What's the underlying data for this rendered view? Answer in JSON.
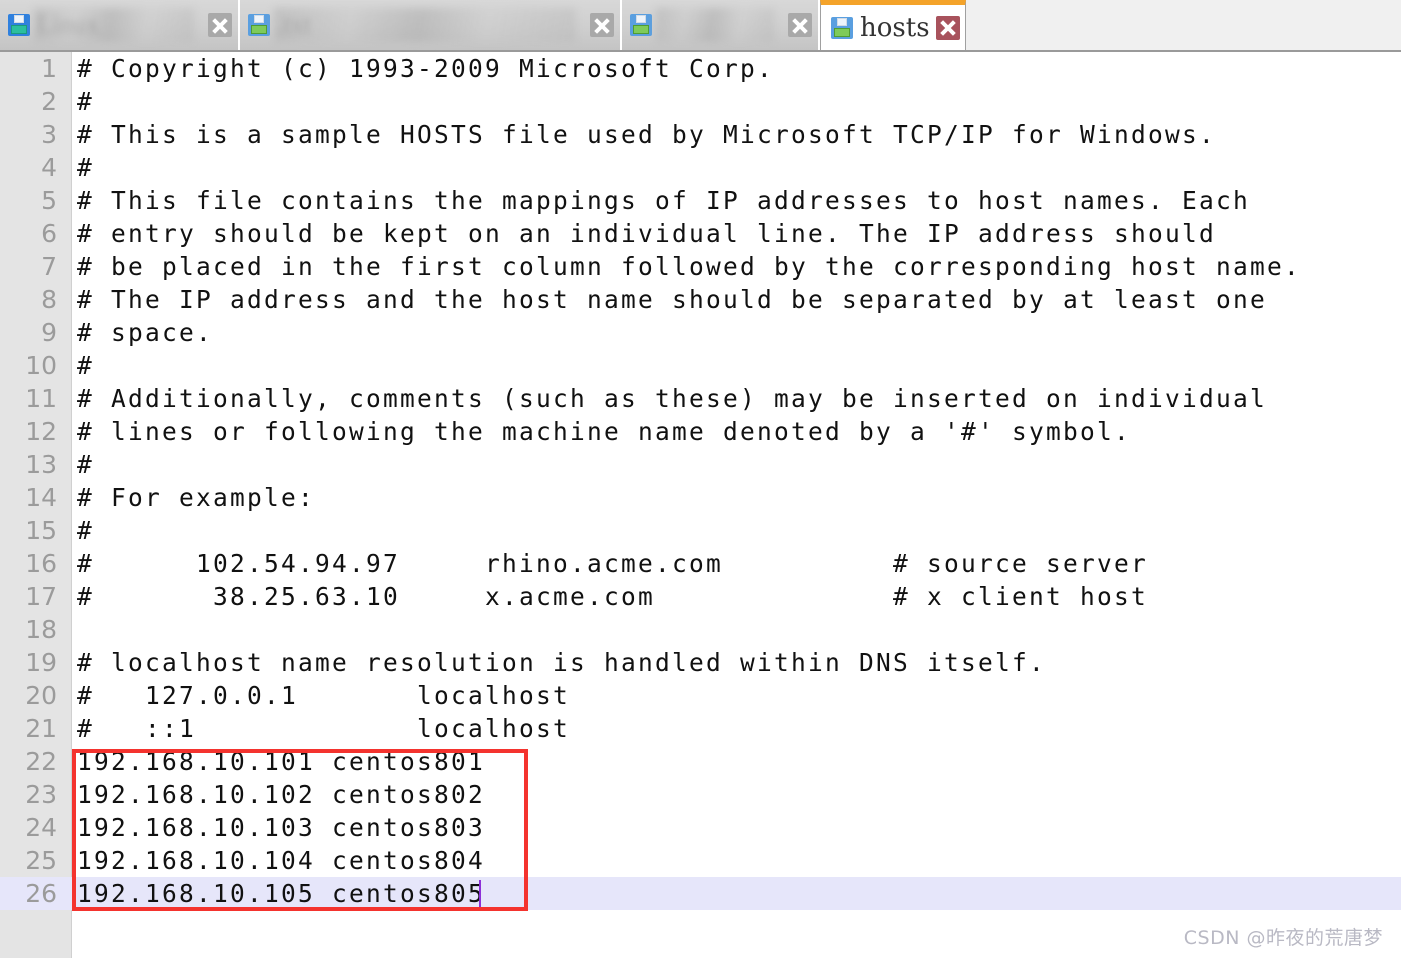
{
  "window": {
    "accent_active_tab": "#f4a32a",
    "annotation_color": "#f4332e",
    "current_line_highlight": "#e6e6fa",
    "gutter_color": "#e4e4e4"
  },
  "tabbar": {
    "tabs": [
      {
        "title": "Linux",
        "icon": "floppy-disk-icon",
        "close_icon": "close-icon",
        "active": false,
        "obscured": true
      },
      {
        "title": ".txt",
        "icon": "floppy-disk-icon",
        "close_icon": "close-icon",
        "active": false,
        "obscured": true
      },
      {
        "title": "",
        "icon": "floppy-disk-icon",
        "close_icon": "close-icon",
        "active": false,
        "obscured": true
      },
      {
        "title": "hosts",
        "icon": "floppy-disk-icon",
        "close_icon": "close-icon",
        "active": true,
        "obscured": false
      }
    ]
  },
  "editor": {
    "filename": "hosts",
    "cursor_line": 26,
    "lines": [
      {
        "n": "1",
        "text": "# Copyright (c) 1993-2009 Microsoft Corp."
      },
      {
        "n": "2",
        "text": "#"
      },
      {
        "n": "3",
        "text": "# This is a sample HOSTS file used by Microsoft TCP/IP for Windows."
      },
      {
        "n": "4",
        "text": "#"
      },
      {
        "n": "5",
        "text": "# This file contains the mappings of IP addresses to host names. Each"
      },
      {
        "n": "6",
        "text": "# entry should be kept on an individual line. The IP address should"
      },
      {
        "n": "7",
        "text": "# be placed in the first column followed by the corresponding host name."
      },
      {
        "n": "8",
        "text": "# The IP address and the host name should be separated by at least one"
      },
      {
        "n": "9",
        "text": "# space."
      },
      {
        "n": "10",
        "text": "#"
      },
      {
        "n": "11",
        "text": "# Additionally, comments (such as these) may be inserted on individual"
      },
      {
        "n": "12",
        "text": "# lines or following the machine name denoted by a '#' symbol."
      },
      {
        "n": "13",
        "text": "#"
      },
      {
        "n": "14",
        "text": "# For example:"
      },
      {
        "n": "15",
        "text": "#"
      },
      {
        "n": "16",
        "text": "#      102.54.94.97     rhino.acme.com          # source server"
      },
      {
        "n": "17",
        "text": "#       38.25.63.10     x.acme.com              # x client host"
      },
      {
        "n": "18",
        "text": ""
      },
      {
        "n": "19",
        "text": "# localhost name resolution is handled within DNS itself."
      },
      {
        "n": "20",
        "text": "#   127.0.0.1       localhost"
      },
      {
        "n": "21",
        "text": "#   ::1             localhost"
      },
      {
        "n": "22",
        "text": "192.168.10.101 centos801"
      },
      {
        "n": "23",
        "text": "192.168.10.102 centos802"
      },
      {
        "n": "24",
        "text": "192.168.10.103 centos803"
      },
      {
        "n": "25",
        "text": "192.168.10.104 centos804"
      },
      {
        "n": "26",
        "text": "192.168.10.105 centos805"
      }
    ],
    "highlighted_entries": [
      {
        "ip": "192.168.10.101",
        "host": "centos801"
      },
      {
        "ip": "192.168.10.102",
        "host": "centos802"
      },
      {
        "ip": "192.168.10.103",
        "host": "centos803"
      },
      {
        "ip": "192.168.10.104",
        "host": "centos804"
      },
      {
        "ip": "192.168.10.105",
        "host": "centos805"
      }
    ]
  },
  "watermark": {
    "text": "CSDN @昨夜的荒唐梦"
  }
}
